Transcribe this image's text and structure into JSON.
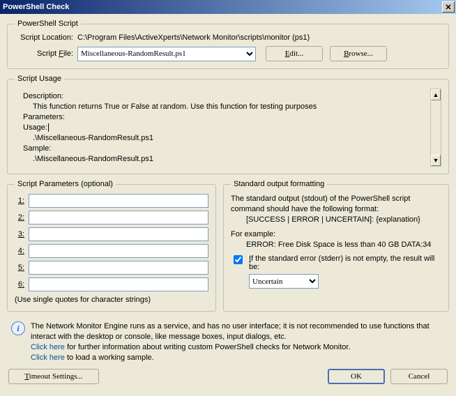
{
  "title": "PowerShell Check",
  "groups": {
    "script": {
      "legend": "PowerShell Script",
      "loc_label": "Script Location:",
      "loc_value": "C:\\Program Files\\ActiveXperts\\Network Monitor\\scripts\\monitor (ps1)",
      "file_label": "Script File:",
      "file_value": "Miscellaneous-RandomResult.ps1",
      "edit_btn": "Edit...",
      "browse_btn": "Browse..."
    },
    "usage": {
      "legend": "Script Usage",
      "desc_h": "Description:",
      "desc_t": "This function returns True or False at random. Use this function for testing purposes",
      "params_h": "Parameters:",
      "usage_h": "Usage:",
      "usage_t": ".\\Miscellaneous-RandomResult.ps1",
      "sample_h": "Sample:",
      "sample_t": ".\\Miscellaneous-RandomResult.ps1"
    },
    "params": {
      "legend": "Script Parameters (optional)",
      "labels": [
        "1:",
        "2:",
        "3:",
        "4:",
        "5:",
        "6:"
      ],
      "note": "(Use single quotes for character strings)"
    },
    "std": {
      "legend": "Standard output formatting",
      "l1": "The standard output (stdout) of the PowerShell script command should have the following format:",
      "l2": "[SUCCESS | ERROR | UNCERTAIN]: {explanation}",
      "l3": "For example:",
      "l4": "ERROR: Free Disk Space is less than 40 GB DATA:34",
      "check": "If the standard error (stderr) is not empty, the result will be:",
      "select": "Uncertain"
    }
  },
  "info": {
    "l1": "The Network Monitor Engine runs as a service, and has no user interface; it is not recommended to use functions that interact with the desktop or console, like message boxes, input dialogs, etc.",
    "link1_a": "Click here",
    "link1_b": " for further information about writing custom PowerShell checks for Network Monitor.",
    "link2_a": "Click here",
    "link2_b": " to load a working sample."
  },
  "bottom": {
    "timeout": "Timeout Settings...",
    "ok": "OK",
    "cancel": "Cancel"
  }
}
